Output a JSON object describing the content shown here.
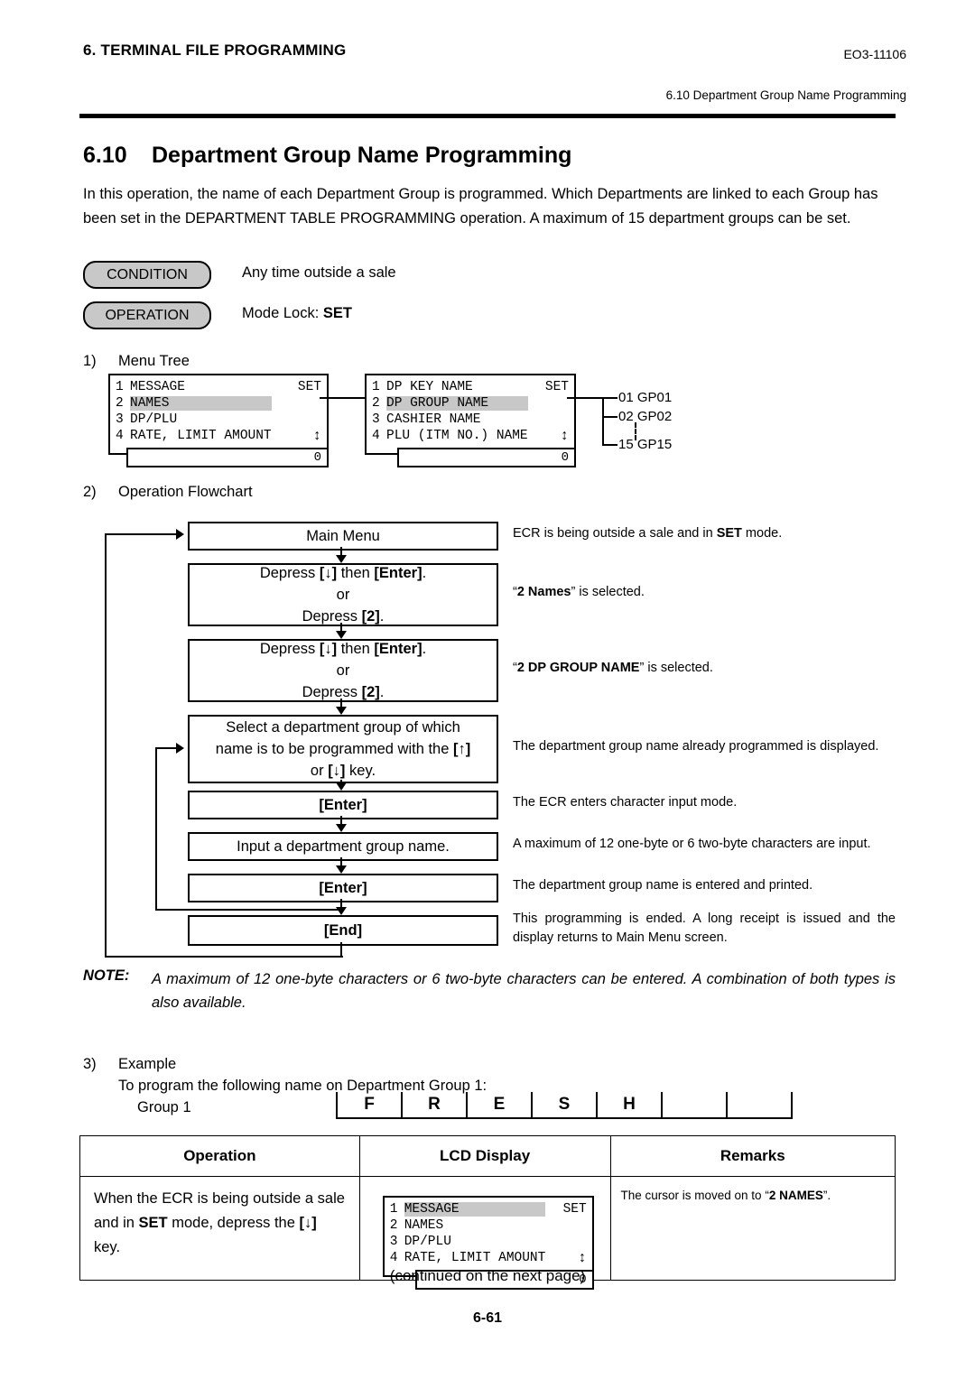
{
  "header": {
    "left": "6. TERMINAL FILE PROGRAMMING",
    "doc_code": "EO3-11106",
    "sub": "6.10 Department Group Name Programming"
  },
  "section": {
    "number": "6.10",
    "title": "Department Group Name Programming",
    "intro": "In this operation, the name of each Department Group is programmed.  Which Departments are linked to each Group has been set in the DEPARTMENT TABLE PROGRAMMING operation.  A maximum of 15 department groups can be set."
  },
  "badges": {
    "condition_label": "CONDITION",
    "condition_value": "Any time outside a sale",
    "operation_label": "OPERATION",
    "operation_value_prefix": "Mode Lock: ",
    "operation_value_bold": "SET"
  },
  "menu_tree": {
    "list_num": "1)",
    "list_label": "Menu Tree",
    "lcd1": {
      "rows": [
        {
          "idx": "1",
          "text": "MESSAGE",
          "right": "SET",
          "highlight": false
        },
        {
          "idx": "2",
          "text": "NAMES",
          "right": "",
          "highlight": true
        },
        {
          "idx": "3",
          "text": "DP/PLU",
          "right": "",
          "highlight": false
        },
        {
          "idx": "4",
          "text": "RATE, LIMIT AMOUNT",
          "right": "",
          "highlight": false
        }
      ],
      "footer": "0"
    },
    "lcd2": {
      "rows": [
        {
          "idx": "1",
          "text": "DP KEY NAME",
          "right": "SET",
          "highlight": false
        },
        {
          "idx": "2",
          "text": "DP GROUP NAME",
          "right": "",
          "highlight": true
        },
        {
          "idx": "3",
          "text": "CASHIER NAME",
          "right": "",
          "highlight": false
        },
        {
          "idx": "4",
          "text": "PLU (ITM NO.) NAME",
          "right": "",
          "highlight": false
        }
      ],
      "footer": "0"
    },
    "groups": [
      "01 GP01",
      "02 GP02",
      "15 GP15"
    ]
  },
  "flowchart": {
    "list_num": "2)",
    "list_label": "Operation Flowchart",
    "steps": [
      {
        "lines": [
          "Main Menu"
        ],
        "remark_html": "ECR is being outside a sale and in <b>SET</b> mode."
      },
      {
        "lines": [
          "Depress [↓] then [Enter].",
          "or",
          "Depress [2]."
        ],
        "remark_html": "“<b>2 Names</b>” is selected."
      },
      {
        "lines": [
          "Depress [↓] then [Enter].",
          "or",
          "Depress [2]."
        ],
        "remark_html": "“<b>2 DP GROUP NAME</b>” is selected."
      },
      {
        "lines": [
          "Select a department group of which",
          "name is to be programmed with the [↑]",
          "or [↓] key."
        ],
        "remark_html": "The department group name already programmed is displayed."
      },
      {
        "lines": [
          "[Enter]"
        ],
        "remark_html": "The ECR enters character input mode."
      },
      {
        "lines": [
          "Input a department group name."
        ],
        "remark_html": "A maximum of 12 one-byte or 6 two-byte characters are input."
      },
      {
        "lines": [
          "[Enter]"
        ],
        "remark_html": "The department group name is entered and printed."
      },
      {
        "lines": [
          "[End]"
        ],
        "remark_html": "This programming is ended.  A long receipt is issued and the display returns to Main Menu screen."
      }
    ]
  },
  "note": {
    "label": "NOTE:",
    "text": "A maximum of 12 one-byte characters or 6 two-byte characters can be entered.  A combination of both types is also available."
  },
  "example": {
    "list_num": "3)",
    "list_label": "Example",
    "line": "To program the following name on Department Group 1:",
    "group_label": "Group 1",
    "cells": [
      "F",
      "R",
      "E",
      "S",
      "H",
      "",
      ""
    ]
  },
  "table": {
    "headers": [
      "Operation",
      "LCD Display",
      "Remarks"
    ],
    "row": {
      "operation_html": "When the ECR is being outside a sale and in <b>SET</b> mode, depress the <b>[↓]</b> key.",
      "lcd": {
        "rows": [
          {
            "idx": "1",
            "text": "MESSAGE",
            "right": "SET",
            "highlight": true
          },
          {
            "idx": "2",
            "text": "NAMES",
            "right": "",
            "highlight": false
          },
          {
            "idx": "3",
            "text": "DP/PLU",
            "right": "",
            "highlight": false
          },
          {
            "idx": "4",
            "text": "RATE, LIMIT AMOUNT",
            "right": "",
            "highlight": false
          }
        ],
        "footer": "0"
      },
      "remarks_html": "The cursor is moved on to “<b>2 NAMES</b>”."
    }
  },
  "footer": {
    "continued": "(continued on the next page)",
    "page_number": "6-61"
  },
  "colors": {
    "highlight": "#c8c8c8",
    "line": "#000000"
  }
}
